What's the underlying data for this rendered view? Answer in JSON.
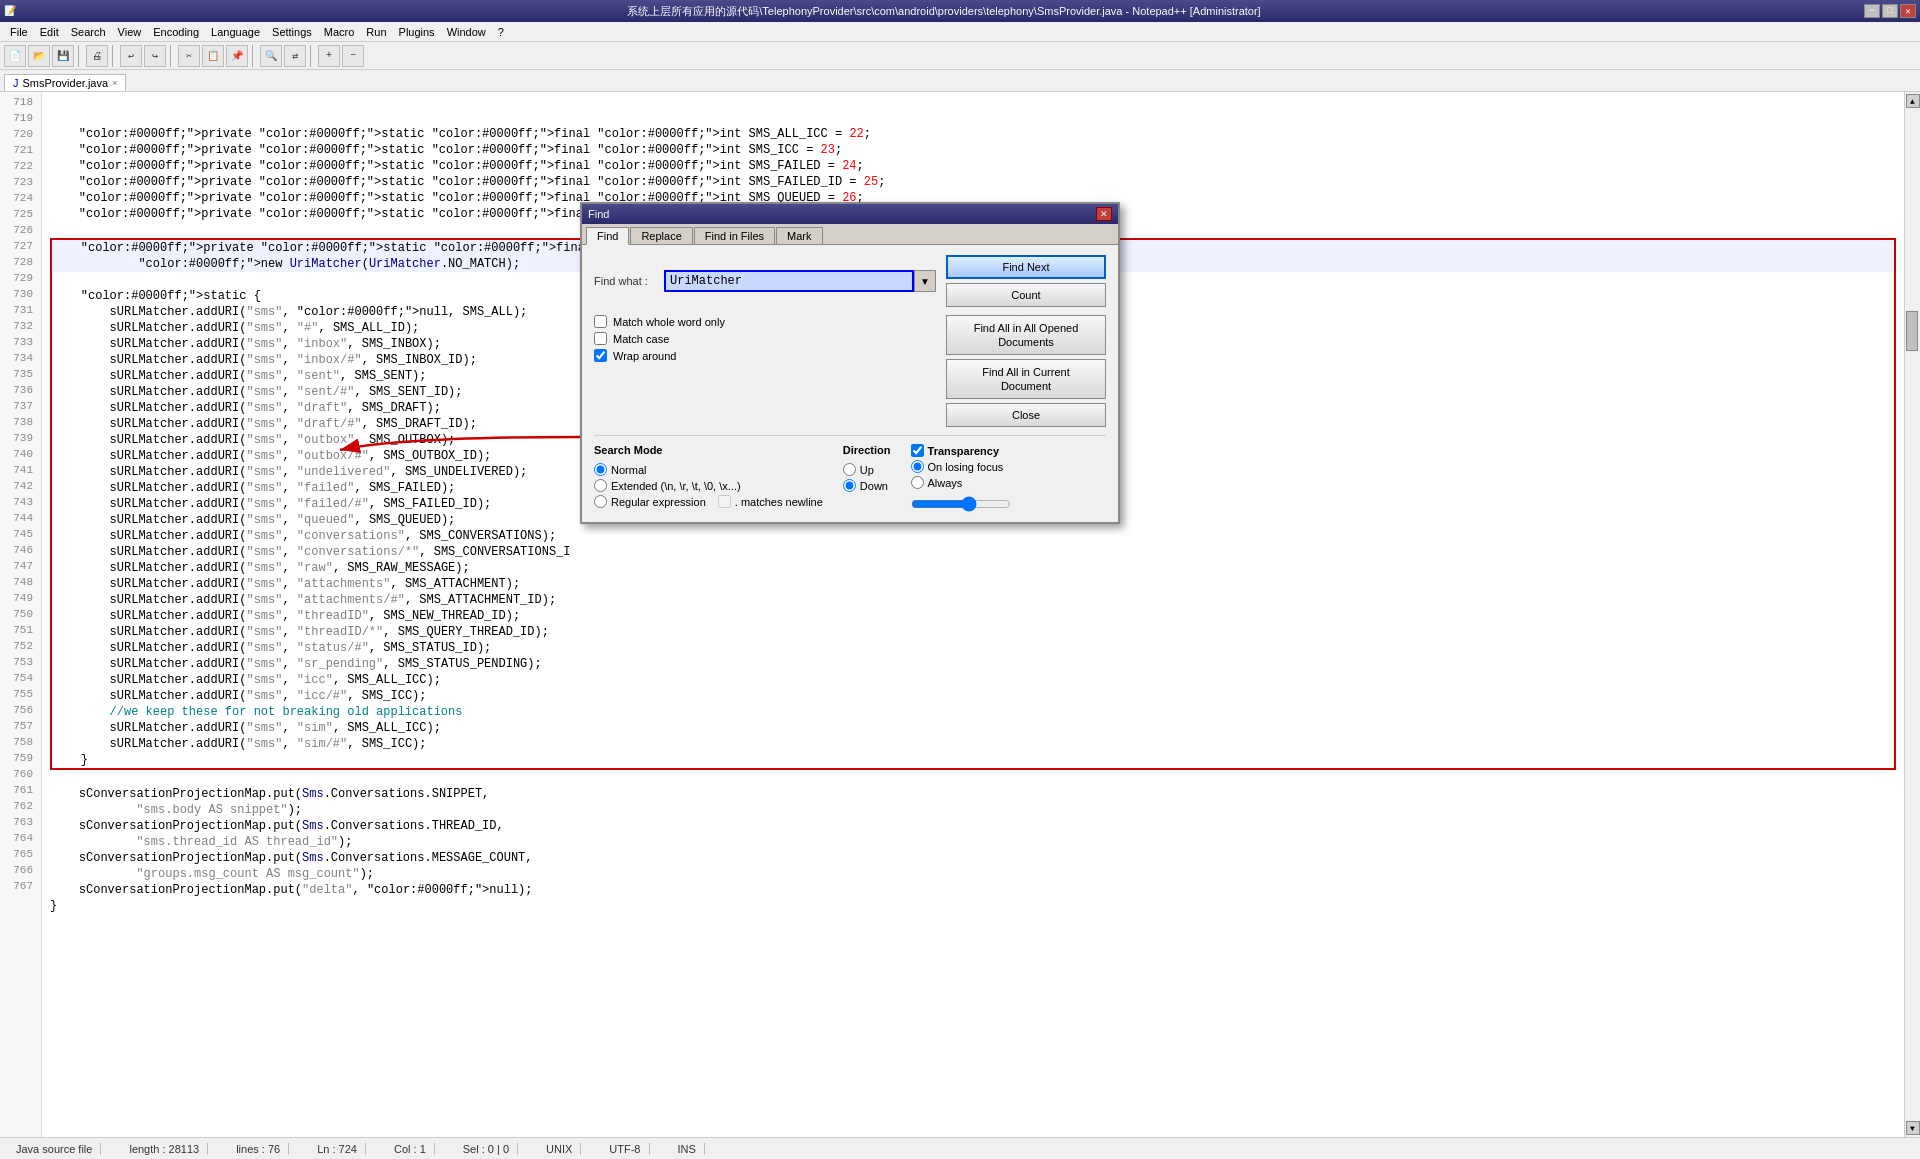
{
  "titlebar": {
    "title": "系统上层所有应用的源代码\\TelephonyProvider\\src\\com\\android\\providers\\telephony\\SmsProvider.java - Notepad++ [Administrator]",
    "minimize": "−",
    "maximize": "□",
    "close": "✕"
  },
  "menubar": {
    "items": [
      "File",
      "Edit",
      "Search",
      "View",
      "Encoding",
      "Language",
      "Settings",
      "Macro",
      "Run",
      "Plugins",
      "Window",
      "?"
    ]
  },
  "tab": {
    "label": "SmsProvider.java",
    "icon": "×"
  },
  "find_dialog": {
    "title": "Find",
    "tabs": [
      "Find",
      "Replace",
      "Find in Files",
      "Mark"
    ],
    "find_what_label": "Find what :",
    "find_what_value": "UriMatcher",
    "dropdown_arrow": "▼",
    "buttons": {
      "find_next": "Find Next",
      "count": "Count",
      "find_all_opened": "Find All in All Opened\nDocuments",
      "find_all_current": "Find All in Current\nDocument",
      "close": "Close"
    },
    "checkboxes": {
      "match_whole_word": {
        "label": "Match whole word only",
        "checked": false
      },
      "match_case": {
        "label": "Match case",
        "checked": false
      },
      "wrap_around": {
        "label": "Wrap around",
        "checked": true
      }
    },
    "search_mode": {
      "title": "Search Mode",
      "options": [
        {
          "label": "Normal",
          "checked": true
        },
        {
          "label": "Extended (\\n, \\r, \\t, \\0, \\x...)",
          "checked": false
        },
        {
          "label": "Regular expression",
          "checked": false
        }
      ],
      "matches_newline_label": "◻ . matches newline"
    },
    "direction": {
      "title": "Direction",
      "options": [
        {
          "label": "Up",
          "checked": false
        },
        {
          "label": "Down",
          "checked": true
        }
      ]
    },
    "transparency": {
      "title": "Transparency",
      "checked": true,
      "options": [
        {
          "label": "On losing focus",
          "checked": true
        },
        {
          "label": "Always",
          "checked": false
        }
      ]
    }
  },
  "code_lines": [
    {
      "num": "718",
      "text": "    private static final int SMS_ALL_ICC = 22;"
    },
    {
      "num": "719",
      "text": "    private static final int SMS_ICC = 23;"
    },
    {
      "num": "720",
      "text": "    private static final int SMS_FAILED = 24;"
    },
    {
      "num": "721",
      "text": "    private static final int SMS_FAILED_ID = 25;"
    },
    {
      "num": "722",
      "text": "    private static final int SMS_QUEUED = 26;"
    },
    {
      "num": "723",
      "text": "    private static final int SMS_UNDELIVERED = 27;"
    },
    {
      "num": "724",
      "text": ""
    },
    {
      "num": "725",
      "text": "    private static final UriMatcher sURLMatcher ="
    },
    {
      "num": "726",
      "text": "            new UriMatcher(UriMatcher.NO_MATCH);"
    },
    {
      "num": "727",
      "text": ""
    },
    {
      "num": "728",
      "text": "    static {"
    },
    {
      "num": "729",
      "text": "        sURLMatcher.addURI(\"sms\", null, SMS_ALL);"
    },
    {
      "num": "730",
      "text": "        sURLMatcher.addURI(\"sms\", \"#\", SMS_ALL_ID);"
    },
    {
      "num": "731",
      "text": "        sURLMatcher.addURI(\"sms\", \"inbox\", SMS_INBOX);"
    },
    {
      "num": "732",
      "text": "        sURLMatcher.addURI(\"sms\", \"inbox/#\", SMS_INBOX_ID);"
    },
    {
      "num": "733",
      "text": "        sURLMatcher.addURI(\"sms\", \"sent\", SMS_SENT);"
    },
    {
      "num": "734",
      "text": "        sURLMatcher.addURI(\"sms\", \"sent/#\", SMS_SENT_ID);"
    },
    {
      "num": "735",
      "text": "        sURLMatcher.addURI(\"sms\", \"draft\", SMS_DRAFT);"
    },
    {
      "num": "736",
      "text": "        sURLMatcher.addURI(\"sms\", \"draft/#\", SMS_DRAFT_ID);"
    },
    {
      "num": "737",
      "text": "        sURLMatcher.addURI(\"sms\", \"outbox\", SMS_OUTBOX);"
    },
    {
      "num": "738",
      "text": "        sURLMatcher.addURI(\"sms\", \"outbox/#\", SMS_OUTBOX_ID);"
    },
    {
      "num": "739",
      "text": "        sURLMatcher.addURI(\"sms\", \"undelivered\", SMS_UNDELIVERED);"
    },
    {
      "num": "740",
      "text": "        sURLMatcher.addURI(\"sms\", \"failed\", SMS_FAILED);"
    },
    {
      "num": "741",
      "text": "        sURLMatcher.addURI(\"sms\", \"failed/#\", SMS_FAILED_ID);"
    },
    {
      "num": "742",
      "text": "        sURLMatcher.addURI(\"sms\", \"queued\", SMS_QUEUED);"
    },
    {
      "num": "743",
      "text": "        sURLMatcher.addURI(\"sms\", \"conversations\", SMS_CONVERSATIONS);"
    },
    {
      "num": "744",
      "text": "        sURLMatcher.addURI(\"sms\", \"conversations/*\", SMS_CONVERSATIONS_I"
    },
    {
      "num": "745",
      "text": "        sURLMatcher.addURI(\"sms\", \"raw\", SMS_RAW_MESSAGE);"
    },
    {
      "num": "746",
      "text": "        sURLMatcher.addURI(\"sms\", \"attachments\", SMS_ATTACHMENT);"
    },
    {
      "num": "747",
      "text": "        sURLMatcher.addURI(\"sms\", \"attachments/#\", SMS_ATTACHMENT_ID);"
    },
    {
      "num": "748",
      "text": "        sURLMatcher.addURI(\"sms\", \"threadID\", SMS_NEW_THREAD_ID);"
    },
    {
      "num": "749",
      "text": "        sURLMatcher.addURI(\"sms\", \"threadID/*\", SMS_QUERY_THREAD_ID);"
    },
    {
      "num": "750",
      "text": "        sURLMatcher.addURI(\"sms\", \"status/#\", SMS_STATUS_ID);"
    },
    {
      "num": "751",
      "text": "        sURLMatcher.addURI(\"sms\", \"sr_pending\", SMS_STATUS_PENDING);"
    },
    {
      "num": "752",
      "text": "        sURLMatcher.addURI(\"sms\", \"icc\", SMS_ALL_ICC);"
    },
    {
      "num": "753",
      "text": "        sURLMatcher.addURI(\"sms\", \"icc/#\", SMS_ICC);"
    },
    {
      "num": "754",
      "text": "        //we keep these for not breaking old applications"
    },
    {
      "num": "755",
      "text": "        sURLMatcher.addURI(\"sms\", \"sim\", SMS_ALL_ICC);"
    },
    {
      "num": "756",
      "text": "        sURLMatcher.addURI(\"sms\", \"sim/#\", SMS_ICC);"
    },
    {
      "num": "757",
      "text": "    }"
    },
    {
      "num": "758",
      "text": ""
    },
    {
      "num": "759",
      "text": "    sConversationProjectionMap.put(Sms.Conversations.SNIPPET,"
    },
    {
      "num": "760",
      "text": "            \"sms.body AS snippet\");"
    },
    {
      "num": "761",
      "text": "    sConversationProjectionMap.put(Sms.Conversations.THREAD_ID,"
    },
    {
      "num": "762",
      "text": "            \"sms.thread_id AS thread_id\");"
    },
    {
      "num": "763",
      "text": "    sConversationProjectionMap.put(Sms.Conversations.MESSAGE_COUNT,"
    },
    {
      "num": "764",
      "text": "            \"groups.msg_count AS msg_count\");"
    },
    {
      "num": "765",
      "text": "    sConversationProjectionMap.put(\"delta\", null);"
    },
    {
      "num": "766",
      "text": "}"
    },
    {
      "num": "767",
      "text": ""
    }
  ],
  "statusbar": {
    "file_type": "Java source file",
    "length": "length : 28113",
    "lines": "lines : 76",
    "ln": "Ln : 724",
    "col": "Col : 1",
    "sel": "Sel : 0 | 0",
    "encoding": "UNIX",
    "format": "UTF-8",
    "mode": "INS"
  }
}
